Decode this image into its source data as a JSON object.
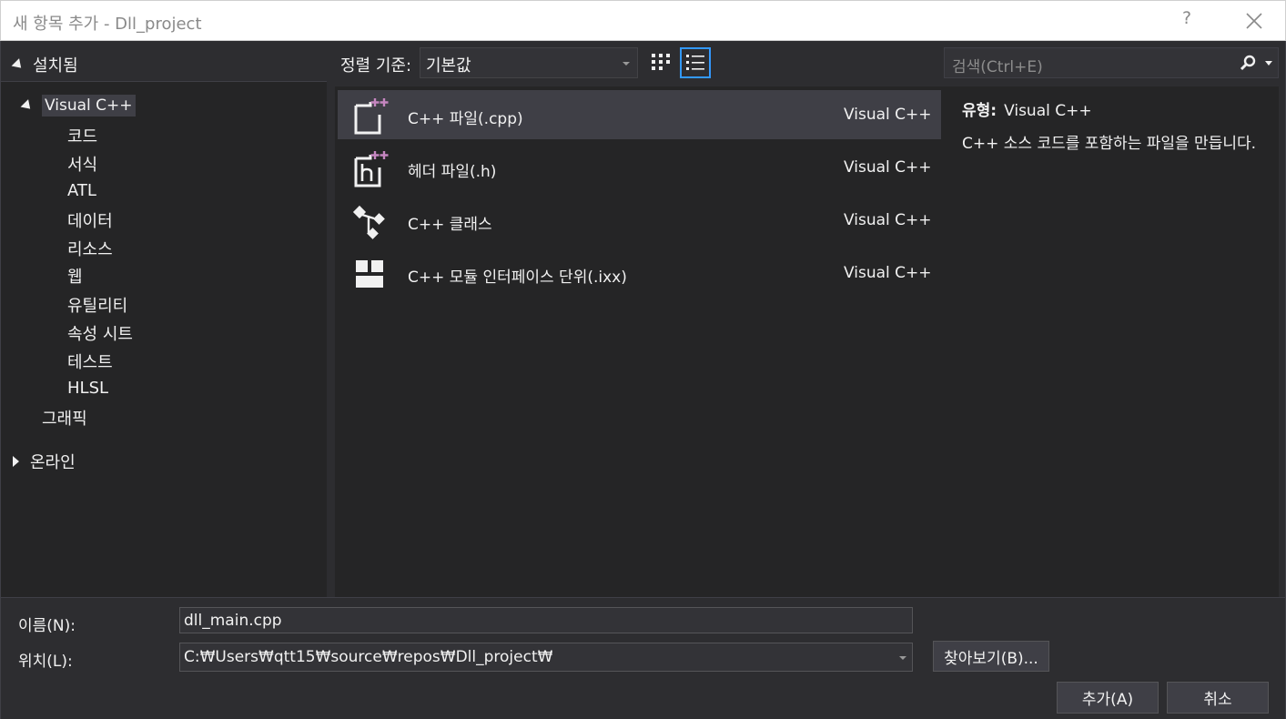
{
  "window": {
    "title": "새 항목 추가 - Dll_project",
    "help_label": "?"
  },
  "sidebar": {
    "installed_label": "설치됨",
    "root_label": "Visual C++",
    "items": [
      "코드",
      "서식",
      "ATL",
      "데이터",
      "리소스",
      "웹",
      "유틸리티",
      "속성 시트",
      "테스트",
      "HLSL"
    ],
    "graphics_label": "그래픽",
    "online_label": "온라인"
  },
  "toolbar": {
    "sort_label": "정렬 기준:",
    "sort_value": "기본값",
    "search_placeholder": "검색(Ctrl+E)"
  },
  "templates": [
    {
      "name": "C++ 파일(.cpp)",
      "lang": "Visual C++",
      "icon": "cpp-file-icon",
      "selected": true
    },
    {
      "name": "헤더 파일(.h)",
      "lang": "Visual C++",
      "icon": "header-file-icon",
      "selected": false
    },
    {
      "name": "C++ 클래스",
      "lang": "Visual C++",
      "icon": "class-icon",
      "selected": false
    },
    {
      "name": "C++ 모듈 인터페이스 단위(.ixx)",
      "lang": "Visual C++",
      "icon": "module-icon",
      "selected": false
    }
  ],
  "details": {
    "type_label": "유형:",
    "type_value": "Visual C++",
    "description": "C++ 소스 코드를 포함하는 파일을 만듭니다."
  },
  "form": {
    "name_label": "이름(N):",
    "name_value": "dll_main.cpp",
    "location_label": "위치(L):",
    "location_value": "C:₩Users₩qtt15₩source₩repos₩Dll_project₩",
    "browse_label": "찾아보기(B)...",
    "add_label": "추가(A)",
    "cancel_label": "취소"
  },
  "colors": {
    "accent": "#3399ff",
    "icon_plus": "#c586c0",
    "background": "#252526",
    "panel": "#2d2d30",
    "selection": "#3f3f46"
  }
}
